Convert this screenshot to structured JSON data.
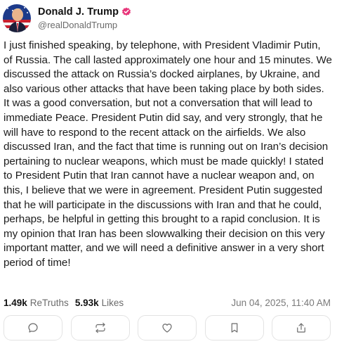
{
  "author": {
    "display_name": "Donald J. Trump",
    "handle": "@realDonaldTrump",
    "verified": true,
    "verified_color": "#e8367a"
  },
  "post": {
    "text": "I just finished speaking, by telephone, with President Vladimir Putin, of Russia. The call lasted approximately one hour and 15 minutes. We discussed the attack on Russia’s docked airplanes, by Ukraine, and also various other attacks that have been taking place by both sides. It was a good conversation, but not a conversation that will lead to immediate Peace. President Putin did say, and very strongly, that he will have to respond to the recent attack on the airfields. We also discussed Iran, and the fact that time is running out on Iran’s decision pertaining to nuclear weapons, which must be made quickly! I stated to President Putin that Iran cannot have a nuclear weapon and, on this, I believe that we were in agreement. President Putin suggested that he will participate in the discussions with Iran and that he could, perhaps, be helpful in getting this brought to a rapid conclusion. It is my opinion that Iran has been slowwalking their decision on this very important matter, and we will need a definitive answer in a very short period of time!",
    "retruths_count": "1.49k",
    "retruths_label": "ReTruths",
    "likes_count": "5.93k",
    "likes_label": "Likes",
    "timestamp": "Jun 04, 2025, 11:40 AM"
  },
  "actions": [
    {
      "icon": "reply-icon"
    },
    {
      "icon": "retruth-icon"
    },
    {
      "icon": "like-icon"
    },
    {
      "icon": "bookmark-icon"
    },
    {
      "icon": "share-icon"
    }
  ],
  "colors": {
    "text": "#1c1c1c",
    "muted": "#6b6b6b",
    "border": "#e3e3e3"
  }
}
